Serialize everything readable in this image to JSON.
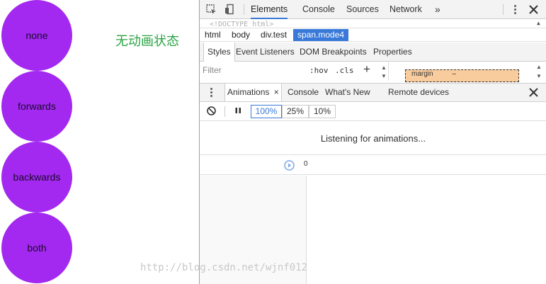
{
  "demo": {
    "circles": [
      "none",
      "forwards",
      "backwards",
      "both"
    ],
    "state_label": "无动画状态",
    "circle_color": "#a329f0",
    "label_color": "#2aa344"
  },
  "devtools": {
    "tabs": [
      "Elements",
      "Console",
      "Sources",
      "Network"
    ],
    "more_icon": "»",
    "doctype_text": "<!DOCTYPE html>",
    "breadcrumbs": [
      "html",
      "body",
      "div.test",
      "span.mode4"
    ],
    "style_tabs": [
      "Styles",
      "Event Listeners",
      "DOM Breakpoints",
      "Properties"
    ],
    "filter_placeholder": "Filter",
    "hov": ":hov",
    "cls": ".cls",
    "plus": "+",
    "margin_label": "margin",
    "margin_value": "–",
    "drawer_tabs": [
      "Animations",
      "Console",
      "What's New",
      "Remote devices"
    ],
    "drawer_tab_close": "×",
    "rates": [
      "100%",
      "25%",
      "10%"
    ],
    "listening_text": "Listening for animations...",
    "timeline_zero": "0",
    "accent": "#3879d9"
  },
  "watermark": "http://blog.csdn.net/wjnf012"
}
